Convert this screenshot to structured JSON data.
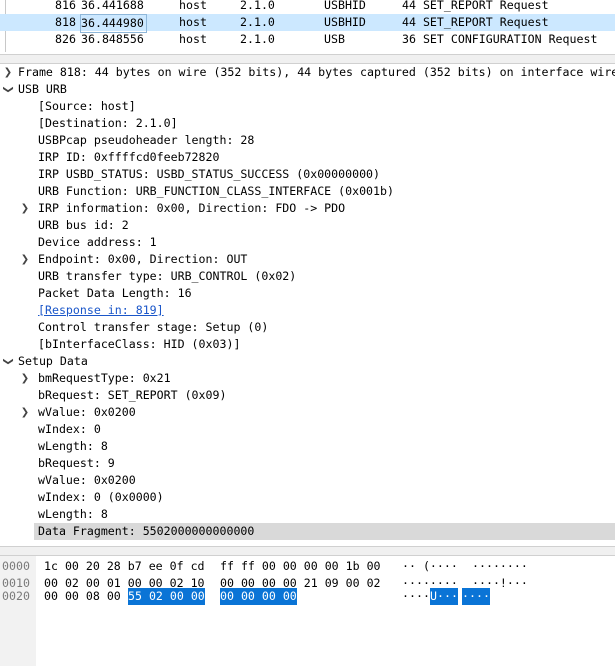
{
  "packet_list": {
    "rows": [
      {
        "no": "816",
        "time": "36.441688",
        "source": "host",
        "destination": "2.1.0",
        "protocol": "USBHID",
        "info": "44 SET_REPORT Request",
        "selected": false
      },
      {
        "no": "818",
        "time": "36.444980",
        "source": "host",
        "destination": "2.1.0",
        "protocol": "USBHID",
        "info": "44 SET_REPORT Request",
        "selected": true
      },
      {
        "no": "826",
        "time": "36.848556",
        "source": "host",
        "destination": "2.1.0",
        "protocol": "USB",
        "info": "36 SET CONFIGURATION Request",
        "selected": false
      }
    ]
  },
  "details": {
    "frame": "Frame 818: 44 bytes on wire (352 bits), 44 bytes captured (352 bits) on interface wire",
    "usb_urb": {
      "label": "USB URB",
      "items": [
        {
          "text": "[Source: host]"
        },
        {
          "text": "[Destination: 2.1.0]"
        },
        {
          "text": "USBPcap pseudoheader length: 28"
        },
        {
          "text": "IRP ID: 0xffffcd0feeb72820"
        },
        {
          "text": "IRP USBD_STATUS: USBD_STATUS_SUCCESS (0x00000000)"
        },
        {
          "text": "URB Function: URB_FUNCTION_CLASS_INTERFACE (0x001b)"
        },
        {
          "text": "IRP information: 0x00, Direction: FDO -> PDO",
          "expandable": true
        },
        {
          "text": "URB bus id: 2"
        },
        {
          "text": "Device address: 1"
        },
        {
          "text": "Endpoint: 0x00, Direction: OUT",
          "expandable": true
        },
        {
          "text": "URB transfer type: URB_CONTROL (0x02)"
        },
        {
          "text": "Packet Data Length: 16"
        },
        {
          "text": "[Response in: 819]",
          "link": true
        },
        {
          "text": "Control transfer stage: Setup (0)"
        },
        {
          "text": "[bInterfaceClass: HID (0x03)]"
        }
      ]
    },
    "setup_data": {
      "label": "Setup Data",
      "items": [
        {
          "text": "bmRequestType: 0x21",
          "expandable": true
        },
        {
          "text": "bRequest: SET_REPORT (0x09)"
        },
        {
          "text": "wValue: 0x0200",
          "expandable": true
        },
        {
          "text": "wIndex: 0"
        },
        {
          "text": "wLength: 8"
        },
        {
          "text": "bRequest: 9"
        },
        {
          "text": "wValue: 0x0200"
        },
        {
          "text": "wIndex: 0 (0x0000)"
        },
        {
          "text": "wLength: 8"
        },
        {
          "text": "Data Fragment: 5502000000000000",
          "highlighted": true
        }
      ]
    }
  },
  "hex": {
    "rows": [
      {
        "offset": "0000",
        "hex_a": "1c 00 20 28 b7 ee 0f cd",
        "hex_b": "ff ff 00 00 00 00 1b 00",
        "ascii_a": "·· (····",
        "ascii_b": "········"
      },
      {
        "offset": "0010",
        "hex_a": "00 02 00 01 00 00 02 10",
        "hex_b": "00 00 00 00 21 09 00 02",
        "ascii_a": "········",
        "ascii_b": "····!···"
      },
      {
        "offset": "0020",
        "hex_a": "00 00 08 00",
        "hex_a_sel": "55 02 00 00",
        "hex_b_sel": "00 00 00 00",
        "ascii_a": "····",
        "ascii_a_sel": "U···",
        "ascii_b_sel": "····"
      }
    ]
  },
  "colors": {
    "selected_row": "#cce8ff",
    "hex_selection": "#0a74d6",
    "link": "#1a56c9",
    "field_highlight": "#d9d9d9"
  }
}
